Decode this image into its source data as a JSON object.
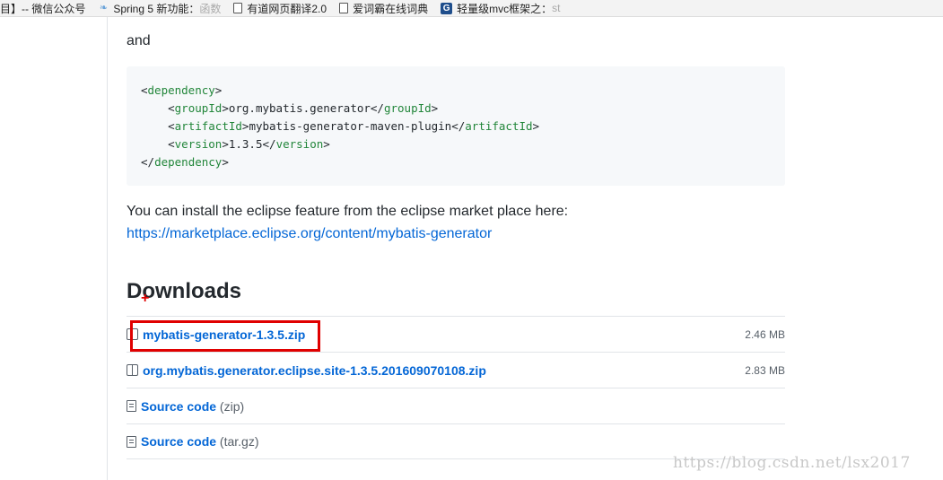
{
  "bookmarks": [
    {
      "icon": "page-icon",
      "label": "目】-- 微信公众号",
      "fade": ""
    },
    {
      "icon": "spring-icon",
      "label": "Spring 5 新功能：",
      "fade": "函数"
    },
    {
      "icon": "page-icon",
      "label": "有道网页翻译2.0",
      "fade": ""
    },
    {
      "icon": "page-icon",
      "label": "爱词霸在线词典",
      "fade": ""
    },
    {
      "icon": "g-icon",
      "label": "轻量级mvc框架之：",
      "fade": "st"
    }
  ],
  "intro_text": "and",
  "code_lines": [
    {
      "indent": "",
      "open": "dependency",
      "text": "",
      "close": ""
    },
    {
      "indent": "    ",
      "open": "groupId",
      "text": "org.mybatis.generator",
      "close": "groupId"
    },
    {
      "indent": "    ",
      "open": "artifactId",
      "text": "mybatis-generator-maven-plugin",
      "close": "artifactId"
    },
    {
      "indent": "    ",
      "open": "version",
      "text": "1.3.5",
      "close": "version"
    },
    {
      "indent": "",
      "open": "",
      "text": "",
      "close": "dependency"
    }
  ],
  "install_text": "You can install the eclipse feature from the eclipse market place here:",
  "install_link": "https://marketplace.eclipse.org/content/mybatis-generator",
  "downloads": {
    "title": "Downloads",
    "items": [
      {
        "icon": "package-icon",
        "name": "mybatis-generator-1.3.5.zip",
        "suffix": "",
        "size": "2.46 MB"
      },
      {
        "icon": "package-icon",
        "name": "org.mybatis.generator.eclipse.site-1.3.5.201609070108.zip",
        "suffix": "",
        "size": "2.83 MB"
      },
      {
        "icon": "file-zip-icon",
        "name": "Source code",
        "suffix": " (zip)",
        "size": ""
      },
      {
        "icon": "file-zip-icon",
        "name": "Source code",
        "suffix": " (tar.gz)",
        "size": ""
      }
    ]
  },
  "watermark": "https://blog.csdn.net/lsx2017",
  "colors": {
    "link": "#0366d6",
    "highlight": "#e00000",
    "xml_tag": "#22863a"
  }
}
